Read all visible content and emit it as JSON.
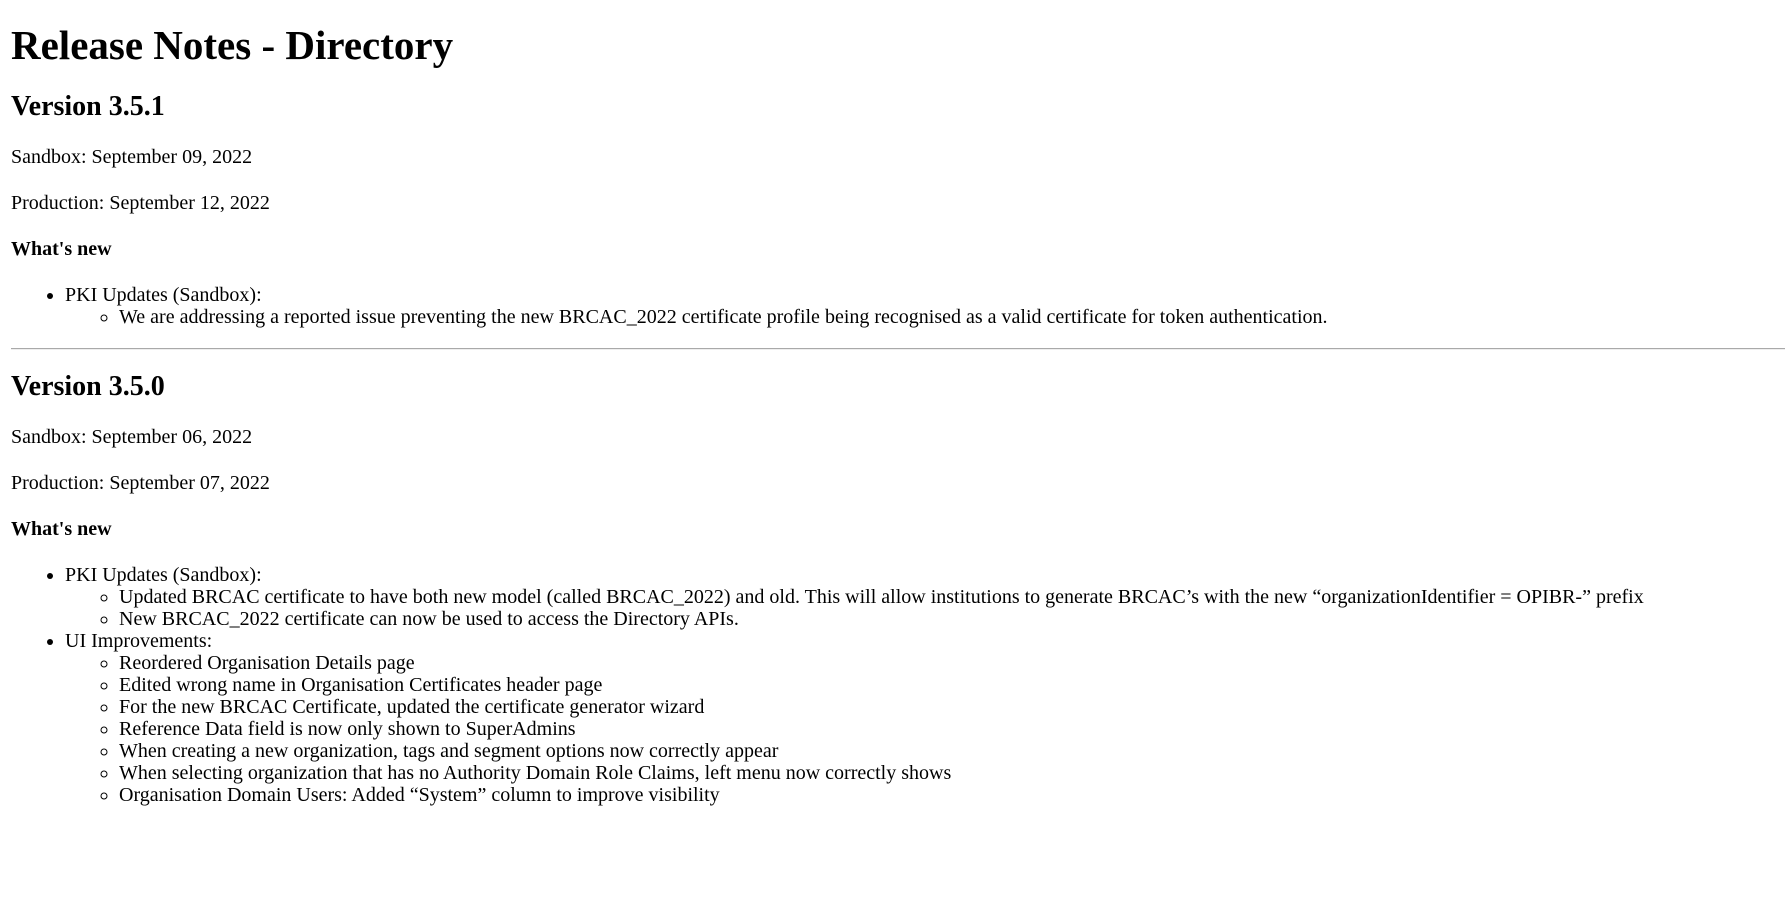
{
  "page_title": "Release Notes - Directory",
  "releases": [
    {
      "version": "Version 3.5.1",
      "sandbox": "Sandbox: September 09, 2022",
      "production": "Production: September 12, 2022",
      "whats_new_heading": "What's new",
      "items": [
        {
          "label": "PKI Updates (Sandbox):",
          "subitems": [
            "We are addressing a reported issue preventing the new BRCAC_2022 certificate profile being recognised as a valid certificate for token authentication."
          ]
        }
      ]
    },
    {
      "version": "Version 3.5.0",
      "sandbox": "Sandbox: September 06, 2022",
      "production": "Production: September 07, 2022",
      "whats_new_heading": "What's new",
      "items": [
        {
          "label": "PKI Updates (Sandbox):",
          "subitems": [
            "Updated BRCAC certificate to have both new model (called BRCAC_2022) and old. This will allow institutions to generate BRCAC’s with the new “organizationIdentifier = OPIBR-” prefix",
            "New BRCAC_2022 certificate can now be used to access the Directory APIs."
          ]
        },
        {
          "label": "UI Improvements:",
          "subitems": [
            "Reordered Organisation Details page",
            "Edited wrong name in Organisation Certificates header page",
            "For the new BRCAC Certificate, updated the certificate generator wizard",
            "Reference Data field is now only shown to SuperAdmins",
            "When creating a new organization, tags and segment options now correctly appear",
            "When selecting organization that has no Authority Domain Role Claims, left menu now correctly shows",
            "Organisation Domain Users: Added “System” column to improve visibility"
          ]
        }
      ]
    }
  ]
}
